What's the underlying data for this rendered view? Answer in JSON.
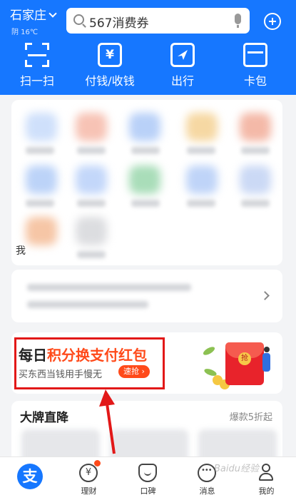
{
  "header": {
    "city": "石家庄",
    "weather": "阴 16℃",
    "search_placeholder": "567消费券"
  },
  "quick_actions": [
    {
      "label": "扫一扫",
      "icon": "scan-icon"
    },
    {
      "label": "付钱/收钱",
      "icon": "yuan-icon"
    },
    {
      "label": "出行",
      "icon": "navigation-arrow-icon"
    },
    {
      "label": "卡包",
      "icon": "wallet-icon"
    }
  ],
  "grid_partial_text": "我",
  "promo": {
    "title_prefix": "每日",
    "title_highlight": "积分换支付红包",
    "subtitle": "买东西当钱用手慢无",
    "cta": "速抢",
    "envelope_char": "抢"
  },
  "brand": {
    "title": "大牌直降",
    "subtitle": "爆款5折起"
  },
  "tabs": [
    {
      "label": "",
      "icon": "alipay-icon",
      "glyph": "支"
    },
    {
      "label": "理财",
      "icon": "finance-icon",
      "glyph": "¥"
    },
    {
      "label": "口碑",
      "icon": "koubei-icon"
    },
    {
      "label": "消息",
      "icon": "message-icon"
    },
    {
      "label": "我的",
      "icon": "profile-icon"
    }
  ],
  "watermark": "Baidu经验",
  "colors": {
    "brand_blue": "#1677ff",
    "promo_red": "#ff4a1a",
    "annotation_red": "#e21818"
  }
}
